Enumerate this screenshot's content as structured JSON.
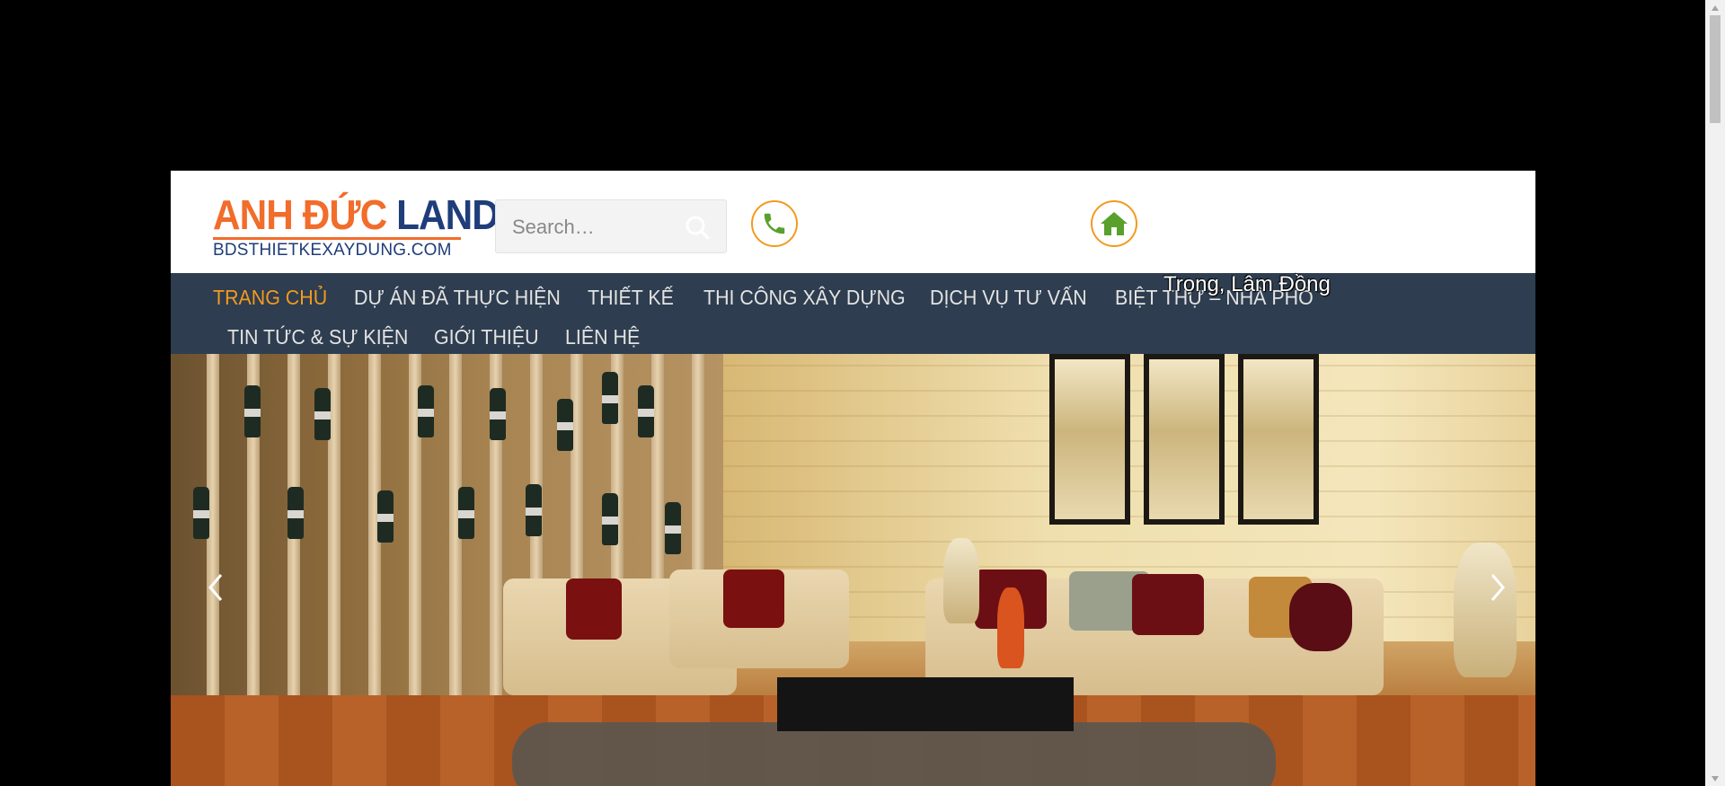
{
  "logo": {
    "part1": "ANH ĐỨC",
    "part2": "LAND",
    "subtitle": "BDSTHIETKEXAYDUNG.COM",
    "colors": {
      "orange": "#f26c2a",
      "blue": "#1f3d7a"
    }
  },
  "search": {
    "placeholder": "Search…",
    "icon": "search-icon"
  },
  "icons": {
    "phone": "phone-icon",
    "home": "home-icon"
  },
  "overlay_text": "Trọng, Lâm Đồng",
  "nav": {
    "background": "#2e3d4f",
    "active_color": "#f39a1e",
    "items": [
      {
        "label": "TRANG CHỦ",
        "active": true
      },
      {
        "label": "DỰ ÁN ĐÃ THỰC HIỆN",
        "active": false
      },
      {
        "label": "THIẾT KẾ",
        "active": false
      },
      {
        "label": "THI CÔNG XÂY DỰNG",
        "active": false
      },
      {
        "label": "DỊCH VỤ TƯ VẤN",
        "active": false
      },
      {
        "label": "BIỆT THỰ – NHÀ PHỐ",
        "active": false
      },
      {
        "label": "TIN TỨC & SỰ KIỆN",
        "active": false
      },
      {
        "label": "GIỚI THIỆU",
        "active": false
      },
      {
        "label": "LIÊN HỆ",
        "active": false
      }
    ]
  },
  "slider": {
    "prev_icon": "chevron-left-icon",
    "next_icon": "chevron-right-icon",
    "image": "living-room-interior"
  }
}
